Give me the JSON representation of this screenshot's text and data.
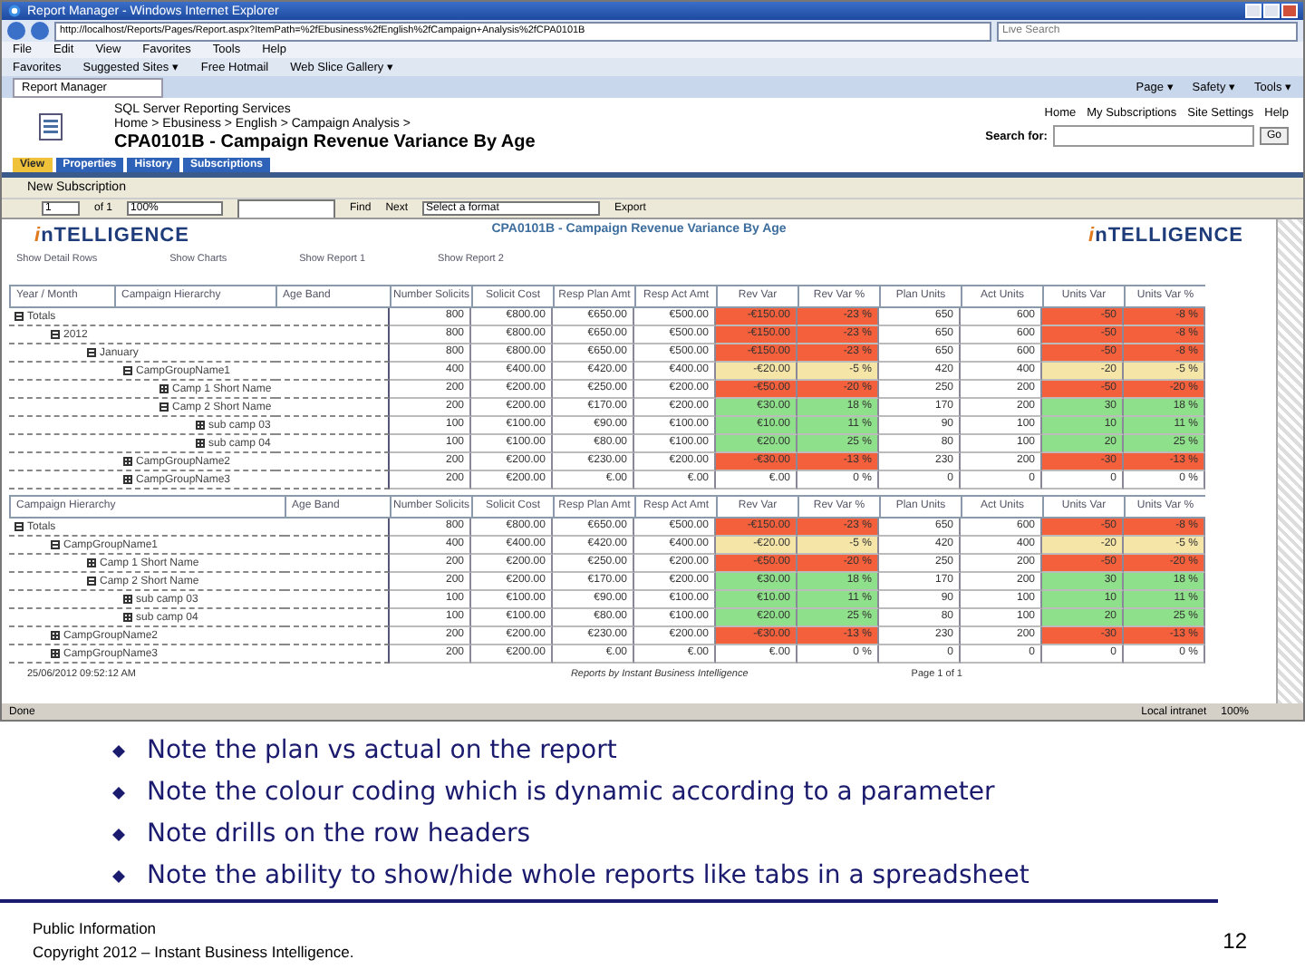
{
  "browser": {
    "title": "Report Manager - Windows Internet Explorer",
    "address": "http://localhost/Reports/Pages/Report.aspx?ItemPath=%2fEbusiness%2fEnglish%2fCampaign+Analysis%2fCPA0101B",
    "search_placeholder": "Live Search",
    "menu": [
      "File",
      "Edit",
      "View",
      "Favorites",
      "Tools",
      "Help"
    ],
    "favorites": [
      "Favorites",
      "Suggested Sites ▾",
      "Free Hotmail",
      "Web Slice Gallery ▾"
    ],
    "tab": "Report Manager",
    "commands": [
      "Page ▾",
      "Safety ▾",
      "Tools ▾"
    ]
  },
  "header": {
    "product": "SQL Server Reporting Services",
    "breadcrumb": "Home > Ebusiness > English > Campaign Analysis >",
    "title": "CPA0101B - Campaign Revenue Variance By Age",
    "links": [
      "Home",
      "My Subscriptions",
      "Site Settings",
      "Help"
    ],
    "search_label": "Search for:",
    "go": "Go"
  },
  "tabs": [
    {
      "label": "View",
      "selected": true
    },
    {
      "label": "Properties",
      "selected": false
    },
    {
      "label": "History",
      "selected": false
    },
    {
      "label": "Subscriptions",
      "selected": false
    }
  ],
  "new_subscription": "New Subscription",
  "toolbar": {
    "page": "1",
    "of": "of 1",
    "zoom": "100%",
    "find": "Find",
    "next": "Next",
    "format": "Select a format",
    "export": "Export"
  },
  "report": {
    "logos": [
      "inTELLIGENCE",
      "inTELLIGENCE"
    ],
    "title": "CPA0101B - Campaign Revenue Variance By Age",
    "toggles": [
      "Show Detail Rows",
      "Show Charts",
      "Show Report 1",
      "Show Report 2"
    ],
    "tables": [
      {
        "columns": [
          "Year / Month",
          "Campaign Hierarchy",
          "Age Band",
          "Number Solicits",
          "Solicit Cost",
          "Resp Plan Amt",
          "Resp Act Amt",
          "Rev Var",
          "Rev Var %",
          "Plan Units",
          "Act Units",
          "Units Var",
          "Units Var %"
        ],
        "rows": [
          {
            "label": "Totals",
            "expanded": true,
            "color": "#f4603c",
            "cells": [
              "",
              "",
              "",
              "800",
              "€800.00",
              "€650.00",
              "€500.00",
              "-€150.00",
              "-23 %",
              "650",
              "600",
              "-50",
              "-8 %"
            ],
            "children": [
              {
                "label": "2012",
                "expanded": true,
                "color": "#f4603c",
                "cells": [
                  "",
                  "",
                  "",
                  "800",
                  "€800.00",
                  "€650.00",
                  "€500.00",
                  "-€150.00",
                  "-23 %",
                  "650",
                  "600",
                  "-50",
                  "-8 %"
                ],
                "children": [
                  {
                    "label": "January",
                    "expanded": true,
                    "color": "#f4603c",
                    "cells": [
                      "",
                      "",
                      "",
                      "800",
                      "€800.00",
                      "€650.00",
                      "€500.00",
                      "-€150.00",
                      "-23 %",
                      "650",
                      "600",
                      "-50",
                      "-8 %"
                    ],
                    "children": [
                      {
                        "label": "CampGroupName1",
                        "expanded": true,
                        "color": "#f5e6a8",
                        "cells": [
                          "",
                          "",
                          "",
                          "400",
                          "€400.00",
                          "€420.00",
                          "€400.00",
                          "-€20.00",
                          "-5 %",
                          "420",
                          "400",
                          "-20",
                          "-5 %"
                        ],
                        "children": [
                          {
                            "label": "Camp 1 Short Name",
                            "expanded": false,
                            "color": "#f4603c",
                            "cells": [
                              "",
                              "",
                              "",
                              "200",
                              "€200.00",
                              "€250.00",
                              "€200.00",
                              "-€50.00",
                              "-20 %",
                              "250",
                              "200",
                              "-50",
                              "-20 %"
                            ]
                          },
                          {
                            "label": "Camp 2 Short Name",
                            "expanded": true,
                            "color": "#8fe08a",
                            "cells": [
                              "",
                              "",
                              "",
                              "200",
                              "€200.00",
                              "€170.00",
                              "€200.00",
                              "€30.00",
                              "18 %",
                              "170",
                              "200",
                              "30",
                              "18 %"
                            ],
                            "children": [
                              {
                                "label": "sub camp 03",
                                "expanded": false,
                                "color": "#8fe08a",
                                "cells": [
                                  "",
                                  "",
                                  "",
                                  "100",
                                  "€100.00",
                                  "€90.00",
                                  "€100.00",
                                  "€10.00",
                                  "11 %",
                                  "90",
                                  "100",
                                  "10",
                                  "11 %"
                                ]
                              },
                              {
                                "label": "sub camp 04",
                                "expanded": false,
                                "color": "#8fe08a",
                                "cells": [
                                  "",
                                  "",
                                  "",
                                  "100",
                                  "€100.00",
                                  "€80.00",
                                  "€100.00",
                                  "€20.00",
                                  "25 %",
                                  "80",
                                  "100",
                                  "20",
                                  "25 %"
                                ]
                              }
                            ]
                          }
                        ]
                      },
                      {
                        "label": "CampGroupName2",
                        "expanded": false,
                        "color": "#f4603c",
                        "cells": [
                          "",
                          "",
                          "",
                          "200",
                          "€200.00",
                          "€230.00",
                          "€200.00",
                          "-€30.00",
                          "-13 %",
                          "230",
                          "200",
                          "-30",
                          "-13 %"
                        ]
                      },
                      {
                        "label": "CampGroupName3",
                        "expanded": false,
                        "color": "#ffffff",
                        "cells": [
                          "",
                          "",
                          "",
                          "200",
                          "€200.00",
                          "€.00",
                          "€.00",
                          "€.00",
                          "0 %",
                          "0",
                          "0",
                          "0",
                          "0 %"
                        ]
                      }
                    ]
                  }
                ]
              }
            ]
          }
        ]
      },
      {
        "columns": [
          "Campaign Hierarchy",
          "Age Band",
          "Number Solicits",
          "Solicit Cost",
          "Resp Plan Amt",
          "Resp Act Amt",
          "Rev Var",
          "Rev Var %",
          "Plan Units",
          "Act Units",
          "Units Var",
          "Units Var %"
        ],
        "rows": [
          {
            "label": "Totals",
            "expanded": true,
            "color": "#f4603c",
            "cells": [
              "",
              "",
              "800",
              "€800.00",
              "€650.00",
              "€500.00",
              "-€150.00",
              "-23 %",
              "650",
              "600",
              "-50",
              "-8 %"
            ],
            "children": [
              {
                "label": "CampGroupName1",
                "expanded": true,
                "color": "#f5e6a8",
                "cells": [
                  "",
                  "",
                  "400",
                  "€400.00",
                  "€420.00",
                  "€400.00",
                  "-€20.00",
                  "-5 %",
                  "420",
                  "400",
                  "-20",
                  "-5 %"
                ],
                "children": [
                  {
                    "label": "Camp 1 Short Name",
                    "expanded": false,
                    "color": "#f4603c",
                    "cells": [
                      "",
                      "",
                      "200",
                      "€200.00",
                      "€250.00",
                      "€200.00",
                      "-€50.00",
                      "-20 %",
                      "250",
                      "200",
                      "-50",
                      "-20 %"
                    ]
                  },
                  {
                    "label": "Camp 2 Short Name",
                    "expanded": true,
                    "color": "#8fe08a",
                    "cells": [
                      "",
                      "",
                      "200",
                      "€200.00",
                      "€170.00",
                      "€200.00",
                      "€30.00",
                      "18 %",
                      "170",
                      "200",
                      "30",
                      "18 %"
                    ],
                    "children": [
                      {
                        "label": "sub camp 03",
                        "expanded": false,
                        "color": "#8fe08a",
                        "cells": [
                          "",
                          "",
                          "100",
                          "€100.00",
                          "€90.00",
                          "€100.00",
                          "€10.00",
                          "11 %",
                          "90",
                          "100",
                          "10",
                          "11 %"
                        ]
                      },
                      {
                        "label": "sub camp 04",
                        "expanded": false,
                        "color": "#8fe08a",
                        "cells": [
                          "",
                          "",
                          "100",
                          "€100.00",
                          "€80.00",
                          "€100.00",
                          "€20.00",
                          "25 %",
                          "80",
                          "100",
                          "20",
                          "25 %"
                        ]
                      }
                    ]
                  }
                ]
              },
              {
                "label": "CampGroupName2",
                "expanded": false,
                "color": "#f4603c",
                "cells": [
                  "",
                  "",
                  "200",
                  "€200.00",
                  "€230.00",
                  "€200.00",
                  "-€30.00",
                  "-13 %",
                  "230",
                  "200",
                  "-30",
                  "-13 %"
                ]
              },
              {
                "label": "CampGroupName3",
                "expanded": false,
                "color": "#ffffff",
                "cells": [
                  "",
                  "",
                  "200",
                  "€200.00",
                  "€.00",
                  "€.00",
                  "€.00",
                  "0 %",
                  "0",
                  "0",
                  "0",
                  "0 %"
                ]
              }
            ]
          }
        ]
      }
    ],
    "timestamp": "25/06/2012 09:52:12 AM",
    "credit": "Reports by Instant Business Intelligence",
    "page": "Page 1 of 1"
  },
  "status_bar": {
    "text": "Done",
    "zone": "Local intranet",
    "zoom": "100%"
  },
  "slide": {
    "bullets": [
      "Note the plan vs actual on the report",
      "Note the colour coding which is dynamic according to a parameter",
      "Note drills on the row headers",
      "Note the ability to show/hide whole reports like tabs in a spreadsheet"
    ],
    "footer": [
      "Public Information",
      "Copyright 2012 – Instant Business Intelligence."
    ],
    "page_number": "12"
  }
}
